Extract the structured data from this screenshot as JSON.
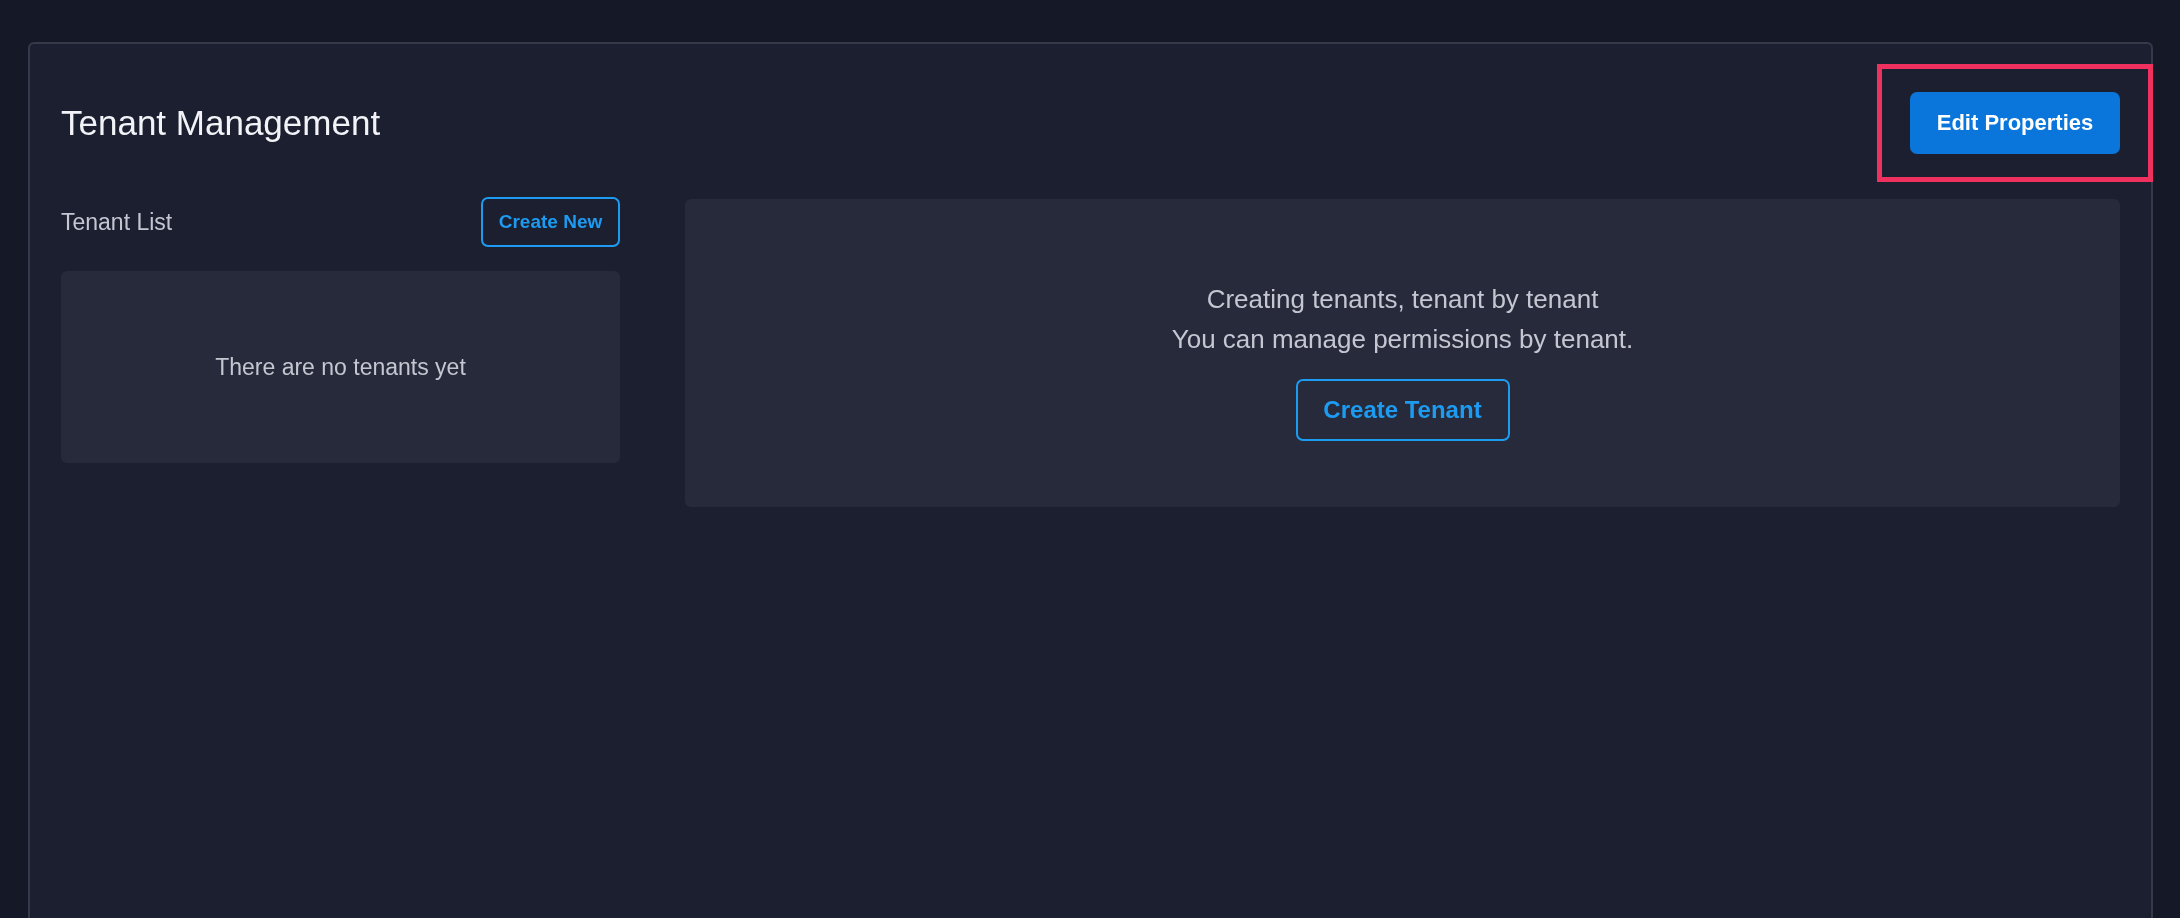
{
  "page": {
    "title": "Tenant Management",
    "edit_button": "Edit Properties",
    "highlighted": true
  },
  "tenant_list": {
    "title": "Tenant List",
    "create_button": "Create New",
    "empty_message": "There are no tenants yet"
  },
  "intro": {
    "lines": [
      "Creating tenants, tenant by tenant",
      "You can manage permissions by tenant."
    ],
    "button": "Create Tenant"
  }
}
